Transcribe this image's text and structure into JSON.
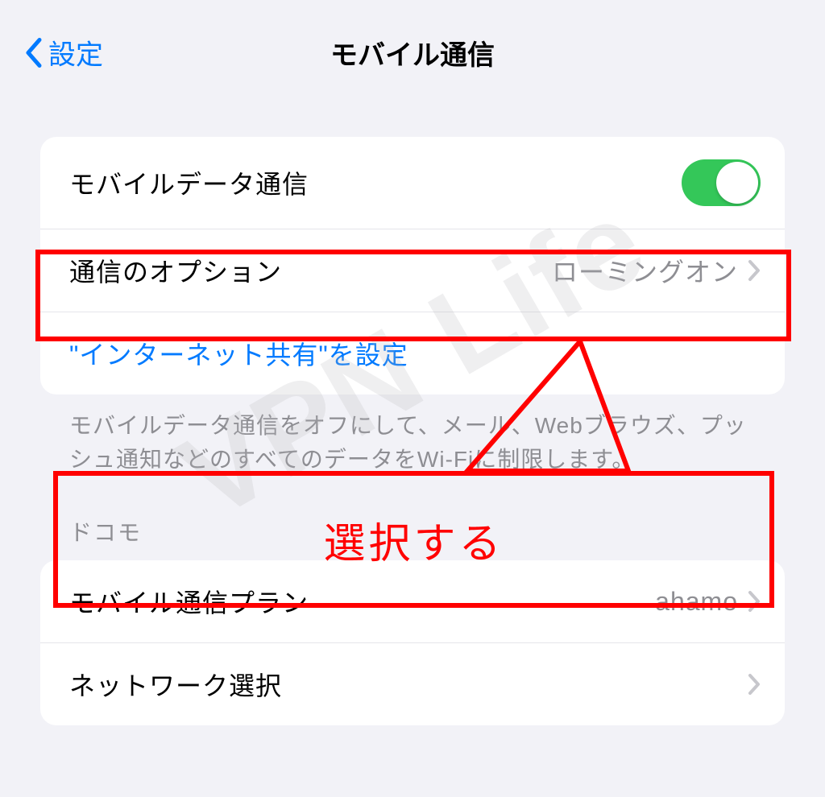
{
  "nav": {
    "back_label": "設定",
    "title": "モバイル通信"
  },
  "group1": {
    "mobile_data_label": "モバイルデータ通信",
    "options_label": "通信のオプション",
    "options_value": "ローミングオン",
    "hotspot_label": "\"インターネット共有\"を設定"
  },
  "footer1": "モバイルデータ通信をオフにして、メール、Webブラウズ、プッシュ通知などのすべてのデータをWi-Fiに制限します。",
  "section2_header": "ドコモ",
  "group2": {
    "plan_label": "モバイル通信プラン",
    "plan_value": "ahamo",
    "network_label": "ネットワーク選択"
  },
  "callout": "選択する",
  "watermark": "VPN Life"
}
